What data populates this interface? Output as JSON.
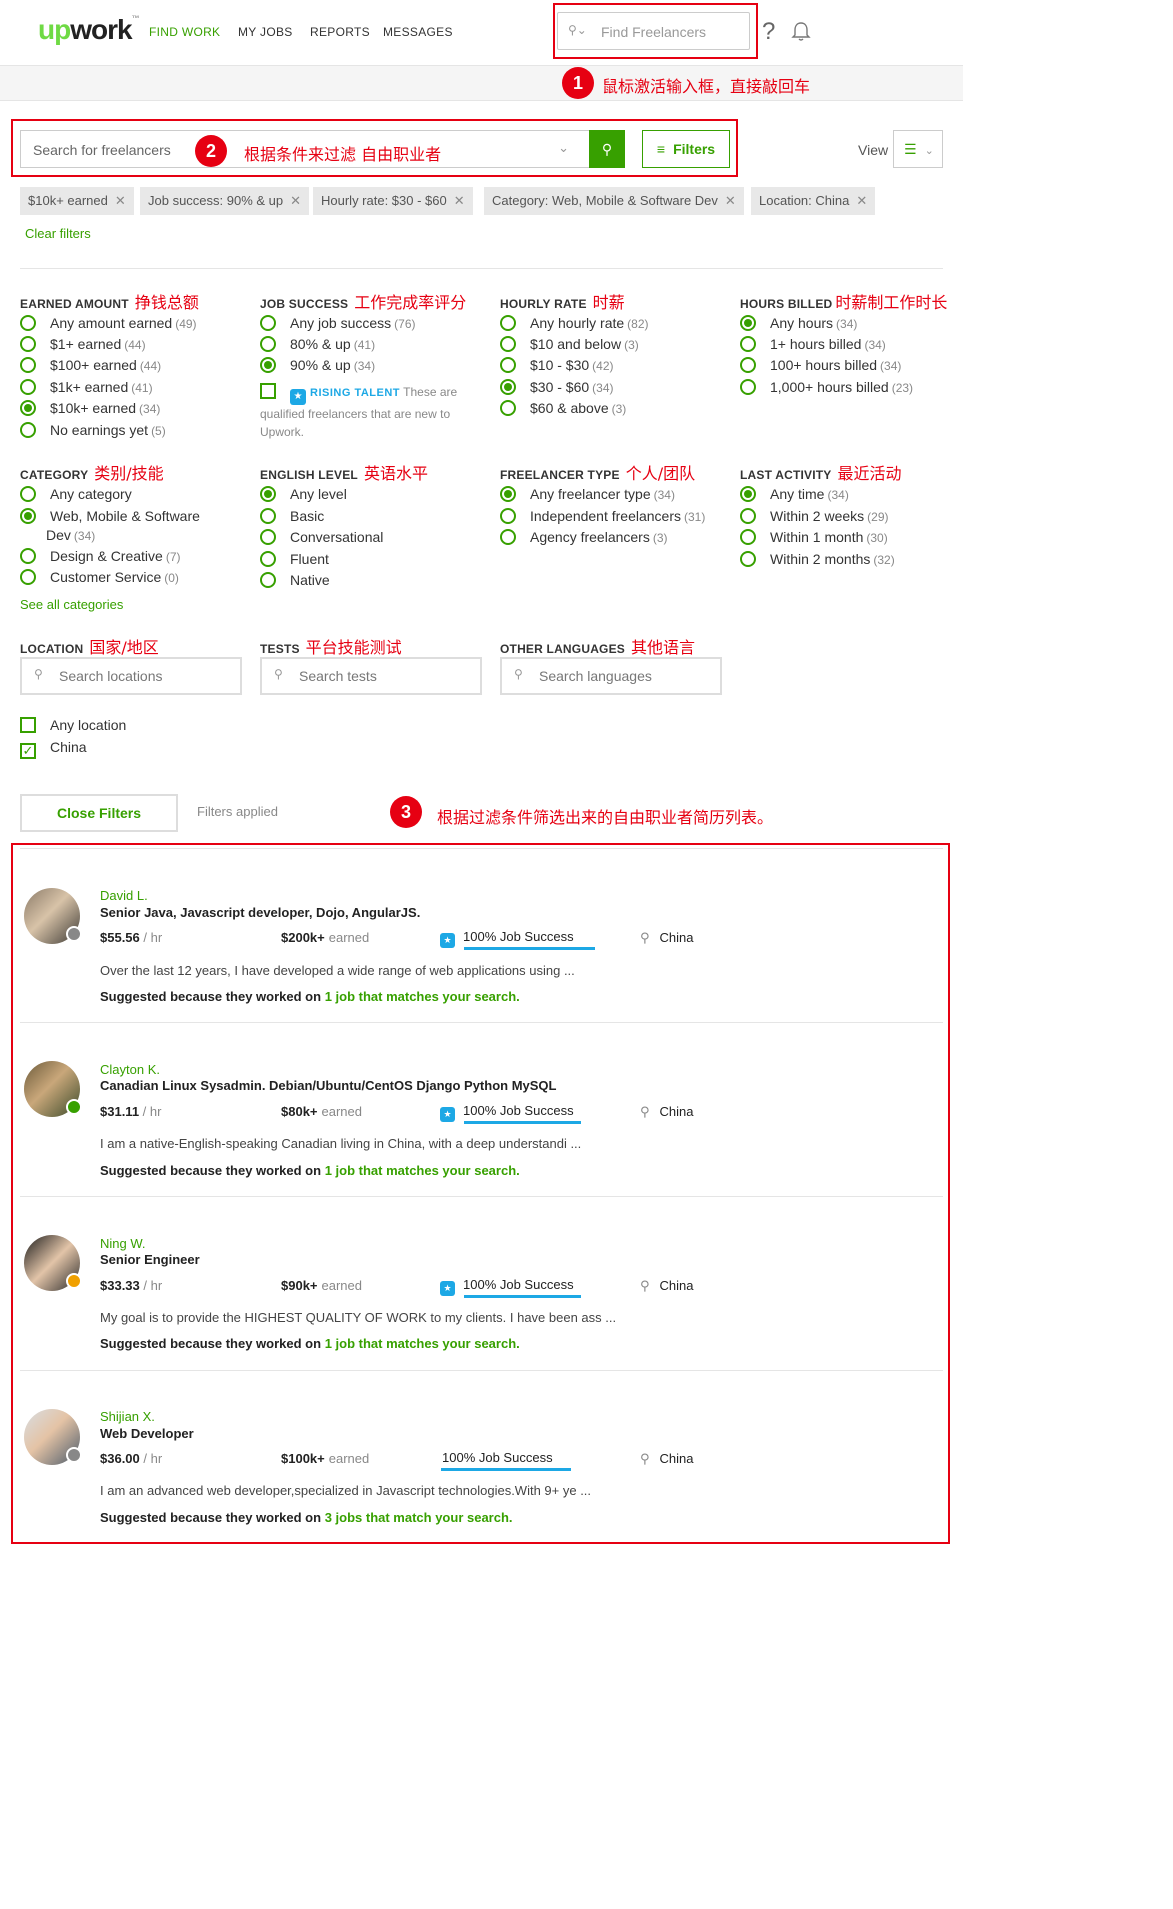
{
  "header": {
    "logo": "upwork",
    "nav": [
      "FIND WORK",
      "MY JOBS",
      "REPORTS",
      "MESSAGES"
    ],
    "search_placeholder": "Find Freelancers",
    "help_icon": "?",
    "annotation1": "鼠标激活输入框，直接敲回车",
    "badge1": "1"
  },
  "search": {
    "placeholder": "Search for freelancers",
    "badge2": "2",
    "annotation2": "根据条件来过滤 自由职业者",
    "filters_label": "Filters",
    "view_label": "View"
  },
  "chips": [
    "$10k+ earned",
    "Job success: 90% & up",
    "Hourly rate: $30 - $60",
    "Category: Web, Mobile & Software Dev",
    "Location: China"
  ],
  "clear_filters": "Clear filters",
  "filters": {
    "earned": {
      "title": "EARNED AMOUNT",
      "cn": "挣钱总额",
      "options": [
        {
          "label": "Any amount earned",
          "count": "(49)"
        },
        {
          "label": "$1+ earned",
          "count": "(44)"
        },
        {
          "label": "$100+ earned",
          "count": "(44)"
        },
        {
          "label": "$1k+ earned",
          "count": "(41)"
        },
        {
          "label": "$10k+ earned",
          "count": "(34)"
        },
        {
          "label": "No earnings yet",
          "count": "(5)"
        }
      ]
    },
    "success": {
      "title": "JOB SUCCESS",
      "cn": "工作完成率评分",
      "options": [
        {
          "label": "Any job success",
          "count": "(76)"
        },
        {
          "label": "80% & up",
          "count": "(41)"
        },
        {
          "label": "90% & up",
          "count": "(34)"
        }
      ],
      "rising_label": "RISING TALENT",
      "rising_text": "These are qualified freelancers that are new to Upwork."
    },
    "rate": {
      "title": "HOURLY RATE",
      "cn": "时薪",
      "options": [
        {
          "label": "Any hourly rate",
          "count": "(82)"
        },
        {
          "label": "$10 and below",
          "count": "(3)"
        },
        {
          "label": "$10 - $30",
          "count": "(42)"
        },
        {
          "label": "$30 - $60",
          "count": "(34)"
        },
        {
          "label": "$60 & above",
          "count": "(3)"
        }
      ]
    },
    "hours": {
      "title": "HOURS BILLED",
      "cn": "时薪制工作时长",
      "options": [
        {
          "label": "Any hours",
          "count": "(34)"
        },
        {
          "label": "1+ hours billed",
          "count": "(34)"
        },
        {
          "label": "100+ hours billed",
          "count": "(34)"
        },
        {
          "label": "1,000+ hours billed",
          "count": "(23)"
        }
      ]
    },
    "category": {
      "title": "CATEGORY",
      "cn": "类别/技能",
      "options": [
        {
          "label": "Any category",
          "count": ""
        },
        {
          "label": "Web, Mobile & Software",
          "count": ""
        },
        {
          "label": "Design & Creative",
          "count": "(7)"
        },
        {
          "label": "Customer Service",
          "count": "(0)"
        }
      ],
      "web_cont": "Dev",
      "web_count": "(34)",
      "see_all": "See all categories"
    },
    "english": {
      "title": "ENGLISH LEVEL",
      "cn": "英语水平",
      "options": [
        {
          "label": "Any level"
        },
        {
          "label": "Basic"
        },
        {
          "label": "Conversational"
        },
        {
          "label": "Fluent"
        },
        {
          "label": "Native"
        }
      ]
    },
    "type": {
      "title": "FREELANCER TYPE",
      "cn": "个人/团队",
      "options": [
        {
          "label": "Any freelancer type",
          "count": "(34)"
        },
        {
          "label": "Independent freelancers",
          "count": "(31)"
        },
        {
          "label": "Agency freelancers",
          "count": "(3)"
        }
      ]
    },
    "activity": {
      "title": "LAST ACTIVITY",
      "cn": "最近活动",
      "options": [
        {
          "label": "Any time",
          "count": "(34)"
        },
        {
          "label": "Within 2 weeks",
          "count": "(29)"
        },
        {
          "label": "Within 1 month",
          "count": "(30)"
        },
        {
          "label": "Within 2 months",
          "count": "(32)"
        }
      ]
    },
    "location": {
      "title": "LOCATION",
      "cn": "国家/地区",
      "placeholder": "Search locations",
      "options": [
        {
          "label": "Any location",
          "checked": false
        },
        {
          "label": "China",
          "checked": true
        }
      ]
    },
    "tests": {
      "title": "TESTS",
      "cn": "平台技能测试",
      "placeholder": "Search tests"
    },
    "languages": {
      "title": "OTHER LANGUAGES",
      "cn": "其他语言",
      "placeholder": "Search languages"
    }
  },
  "close_filters": "Close Filters",
  "filters_applied": "Filters applied",
  "badge3": "3",
  "annotation3": "根据过滤条件筛选出来的自由职业者简历列表。",
  "results": [
    {
      "name": "David L.",
      "title": "Senior Java, Javascript developer, Dojo, AngularJS.",
      "rate": "$55.56",
      "per": "/ hr",
      "earned": "$200k+",
      "earned_label": "earned",
      "jss": "100% Job Success",
      "location": "China",
      "desc": "Over the last 12 years, I have developed a wide range of web applications using ...",
      "sugg_pre": "Suggested because they worked on",
      "sugg_link": "1 job that matches your search.",
      "status_color": "#888888"
    },
    {
      "name": "Clayton K.",
      "title": "Canadian Linux Sysadmin. Debian/Ubuntu/CentOS Django Python MySQL",
      "rate": "$31.11",
      "per": "/ hr",
      "earned": "$80k+",
      "earned_label": "earned",
      "jss": "100% Job Success",
      "location": "China",
      "desc": "I am a native-English-speaking Canadian living in China, with a deep understandi ...",
      "sugg_pre": "Suggested because they worked on",
      "sugg_link": "1 job that matches your search.",
      "status_color": "#37a000"
    },
    {
      "name": "Ning W.",
      "title": "Senior Engineer",
      "rate": "$33.33",
      "per": "/ hr",
      "earned": "$90k+",
      "earned_label": "earned",
      "jss": "100% Job Success",
      "location": "China",
      "desc": "My goal is to provide the HIGHEST QUALITY OF WORK to my clients. I have been ass ...",
      "sugg_pre": "Suggested because they worked on",
      "sugg_link": "1 job that matches your search.",
      "status_color": "#f0a000"
    },
    {
      "name": "Shijian X.",
      "title": "Web Developer",
      "rate": "$36.00",
      "per": "/ hr",
      "earned": "$100k+",
      "earned_label": "earned",
      "jss": "100% Job Success",
      "location": "China",
      "desc": "I am an advanced web developer,specialized in Javascript technologies.With 9+ ye ...",
      "sugg_pre": "Suggested because they worked on",
      "sugg_link": "3 jobs that match your search.",
      "status_color": "#888888"
    }
  ]
}
